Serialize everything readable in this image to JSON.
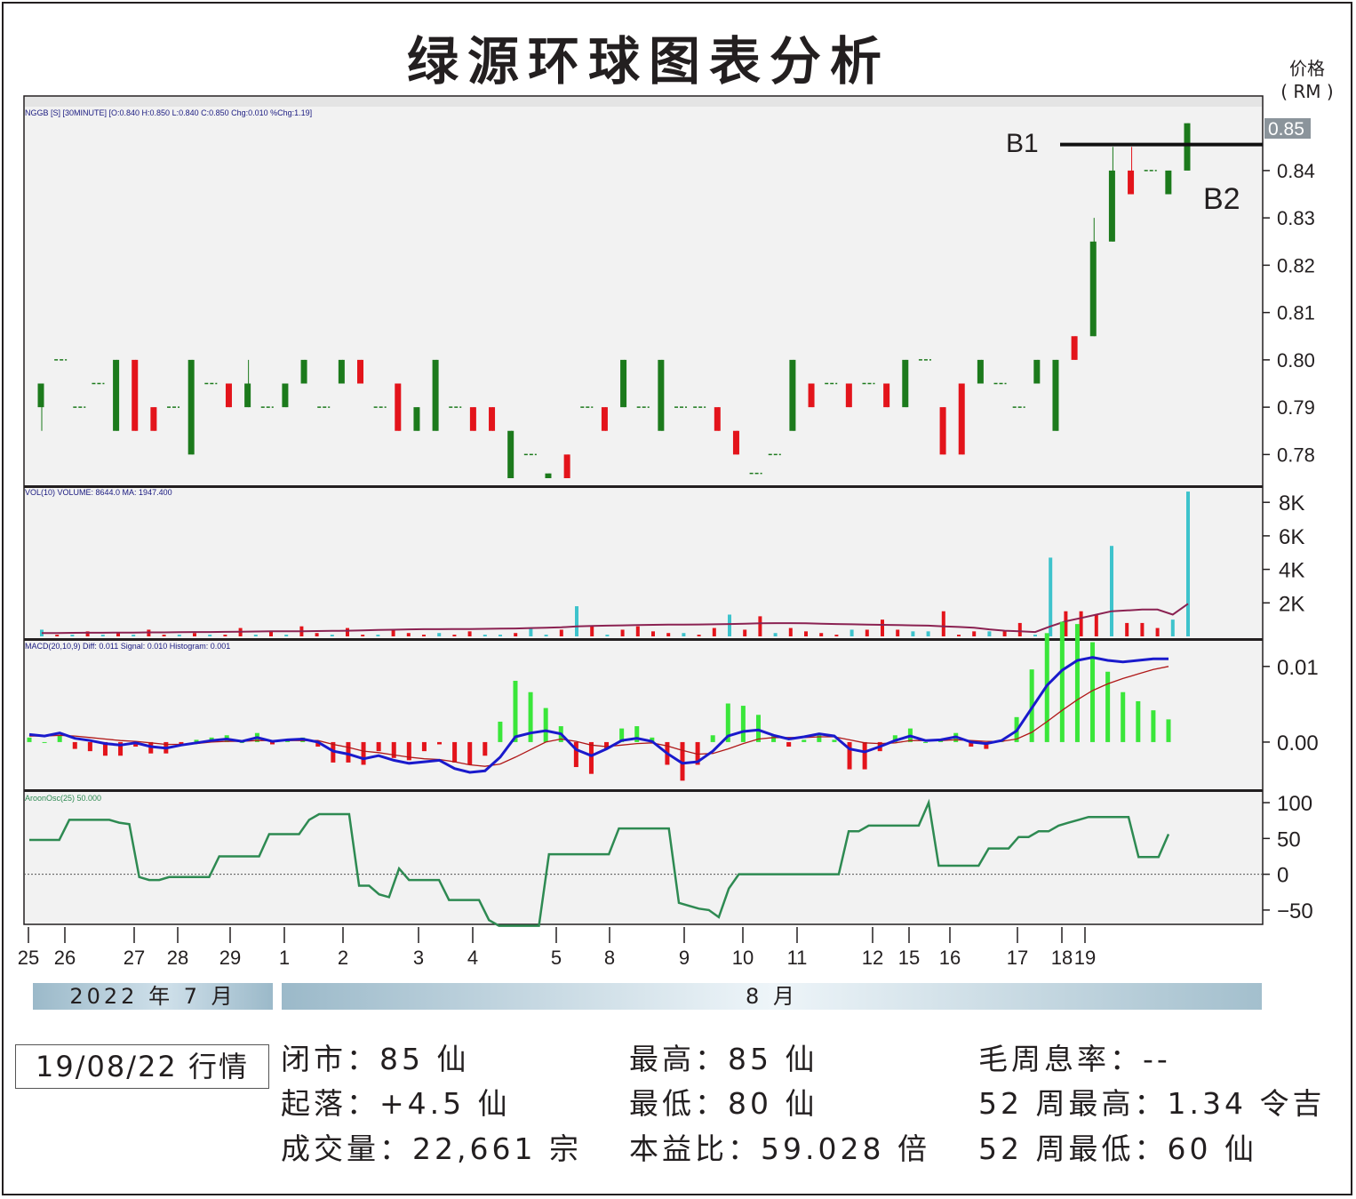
{
  "title": "绿源环球图表分析",
  "price_unit": "价格\n( RM )",
  "annotations": {
    "b1": "B1",
    "b2": "B2",
    "last_price": "0.85"
  },
  "panels": {
    "price_info": "NGGB [S] [30MINUTE] [O:0.840 H:0.850 L:0.840 C:0.850 Chg:0.010 %Chg:1.19]",
    "volume_info": "VOL(10) VOLUME: 8644.0   MA: 1947.400",
    "macd_info": "MACD(20,10,9) Diff: 0.011   Signal: 0.010   Histogram: 0.001",
    "aroon_info": "AroonOsc(25) 50.000"
  },
  "month_labels": {
    "jul": "2022 年 7 月",
    "aug": "8 月"
  },
  "stats": {
    "date": "19/08/22 行情",
    "close": "闭市：85 仙",
    "change": "起落：+4.5 仙",
    "volume": "成交量：22,661 宗",
    "high": "最高：85 仙",
    "low": "最低：80 仙",
    "pe": "本益比：59.028 倍",
    "yield": "毛周息率：--",
    "high52": "52 周最高：1.34 令吉",
    "low52": "52 周最低：60 仙"
  },
  "colors": {
    "up": "#1c7a1c",
    "down": "#e3141b",
    "vol_up": "#3ec3cc",
    "macd": "#1a1acc",
    "signal": "#b01818",
    "hist_up": "#3ae63a",
    "hist_down": "#e3141b",
    "aroon": "#2e8a52",
    "ma": "#8b2252"
  },
  "chart_data": {
    "type": "candlestick",
    "x_tick_labels": [
      "25",
      "26",
      "27",
      "28",
      "29",
      "1",
      "2",
      "3",
      "4",
      "5",
      "8",
      "9",
      "10",
      "11",
      "12",
      "15",
      "16",
      "17",
      "18",
      "19"
    ],
    "x_tick_positions": [
      0,
      2,
      6,
      8,
      10,
      12,
      14,
      16,
      18,
      20,
      22,
      24,
      26,
      28,
      30,
      32,
      34,
      36,
      38,
      39
    ],
    "price_ylim": [
      0.775,
      0.852
    ],
    "price_ticks": [
      "0.78",
      "0.79",
      "0.80",
      "0.81",
      "0.82",
      "0.83",
      "0.84"
    ],
    "resistance_level": 0.8455,
    "candles": [
      [
        0.79,
        0.795,
        0.785,
        0.795
      ],
      [
        0.8,
        0.8,
        0.8,
        0.8
      ],
      [
        0.79,
        0.79,
        0.79,
        0.79
      ],
      [
        0.795,
        0.795,
        0.795,
        0.795
      ],
      [
        0.785,
        0.8,
        0.785,
        0.8
      ],
      [
        0.8,
        0.8,
        0.785,
        0.785
      ],
      [
        0.79,
        0.79,
        0.785,
        0.785
      ],
      [
        0.79,
        0.79,
        0.79,
        0.79
      ],
      [
        0.78,
        0.8,
        0.78,
        0.8
      ],
      [
        0.795,
        0.795,
        0.795,
        0.795
      ],
      [
        0.795,
        0.795,
        0.79,
        0.79
      ],
      [
        0.79,
        0.8,
        0.79,
        0.795
      ],
      [
        0.79,
        0.79,
        0.79,
        0.79
      ],
      [
        0.79,
        0.795,
        0.79,
        0.795
      ],
      [
        0.795,
        0.8,
        0.795,
        0.8
      ],
      [
        0.79,
        0.79,
        0.79,
        0.79
      ],
      [
        0.795,
        0.8,
        0.795,
        0.8
      ],
      [
        0.8,
        0.8,
        0.795,
        0.795
      ],
      [
        0.79,
        0.79,
        0.79,
        0.79
      ],
      [
        0.795,
        0.795,
        0.785,
        0.785
      ],
      [
        0.785,
        0.79,
        0.785,
        0.79
      ],
      [
        0.785,
        0.8,
        0.785,
        0.8
      ],
      [
        0.79,
        0.79,
        0.79,
        0.79
      ],
      [
        0.79,
        0.79,
        0.785,
        0.785
      ],
      [
        0.79,
        0.79,
        0.785,
        0.785
      ],
      [
        0.775,
        0.785,
        0.775,
        0.785
      ],
      [
        0.78,
        0.78,
        0.78,
        0.78
      ],
      [
        0.775,
        0.776,
        0.775,
        0.776
      ],
      [
        0.78,
        0.78,
        0.775,
        0.775
      ],
      [
        0.79,
        0.79,
        0.79,
        0.79
      ],
      [
        0.79,
        0.79,
        0.785,
        0.785
      ],
      [
        0.79,
        0.8,
        0.79,
        0.8
      ],
      [
        0.79,
        0.79,
        0.79,
        0.79
      ],
      [
        0.785,
        0.8,
        0.785,
        0.8
      ],
      [
        0.79,
        0.79,
        0.79,
        0.79
      ],
      [
        0.79,
        0.79,
        0.79,
        0.79
      ],
      [
        0.79,
        0.79,
        0.785,
        0.785
      ],
      [
        0.785,
        0.785,
        0.78,
        0.78
      ],
      [
        0.776,
        0.776,
        0.776,
        0.776
      ],
      [
        0.78,
        0.78,
        0.78,
        0.78
      ],
      [
        0.785,
        0.8,
        0.785,
        0.8
      ],
      [
        0.795,
        0.795,
        0.79,
        0.79
      ],
      [
        0.795,
        0.795,
        0.795,
        0.795
      ],
      [
        0.795,
        0.795,
        0.79,
        0.79
      ],
      [
        0.795,
        0.795,
        0.795,
        0.795
      ],
      [
        0.795,
        0.795,
        0.79,
        0.79
      ],
      [
        0.79,
        0.8,
        0.79,
        0.8
      ],
      [
        0.8,
        0.8,
        0.8,
        0.8
      ],
      [
        0.79,
        0.79,
        0.78,
        0.78
      ],
      [
        0.795,
        0.795,
        0.78,
        0.78
      ],
      [
        0.795,
        0.8,
        0.795,
        0.8
      ],
      [
        0.795,
        0.795,
        0.795,
        0.795
      ],
      [
        0.79,
        0.79,
        0.79,
        0.79
      ],
      [
        0.795,
        0.8,
        0.795,
        0.8
      ],
      [
        0.785,
        0.8,
        0.785,
        0.8
      ],
      [
        0.805,
        0.805,
        0.8,
        0.8
      ],
      [
        0.805,
        0.83,
        0.805,
        0.825
      ],
      [
        0.825,
        0.845,
        0.825,
        0.84
      ],
      [
        0.84,
        0.845,
        0.835,
        0.835
      ],
      [
        0.84,
        0.84,
        0.84,
        0.84
      ],
      [
        0.835,
        0.84,
        0.835,
        0.84
      ],
      [
        0.84,
        0.85,
        0.84,
        0.85
      ]
    ],
    "volume_ylim": [
      0,
      8700
    ],
    "volume_ticks": [
      "8K",
      "6K",
      "4K",
      "2K"
    ],
    "volume": [
      400,
      100,
      100,
      300,
      100,
      200,
      100,
      400,
      100,
      100,
      200,
      100,
      100,
      500,
      100,
      300,
      100,
      600,
      200,
      100,
      500,
      100,
      100,
      400,
      200,
      100,
      200,
      100,
      300,
      100,
      100,
      200,
      500,
      100,
      400,
      1800,
      600,
      100,
      400,
      600,
      300,
      200,
      200,
      100,
      500,
      1300,
      400,
      1200,
      200,
      500,
      300,
      200,
      100,
      400,
      400,
      1000,
      400,
      300,
      300,
      1500,
      100,
      300,
      300,
      300,
      800,
      100,
      4700,
      1500,
      1500,
      1300,
      5400,
      800,
      800,
      500,
      1000,
      8644
    ],
    "volume_up": [
      1,
      0,
      1,
      0,
      1,
      0,
      1,
      0,
      0,
      1,
      0,
      1,
      0,
      0,
      1,
      0,
      1,
      0,
      0,
      1,
      0,
      0,
      1,
      0,
      0,
      0,
      1,
      0,
      0,
      1,
      1,
      0,
      1,
      1,
      0,
      1,
      0,
      1,
      0,
      0,
      0,
      0,
      1,
      0,
      0,
      1,
      0,
      0,
      1,
      0,
      0,
      0,
      0,
      1,
      0,
      0,
      0,
      1,
      1,
      0,
      0,
      0,
      1,
      0,
      0,
      1,
      1,
      0,
      0,
      0,
      1,
      0,
      0,
      0,
      1,
      1
    ],
    "volume_ma": [
      200,
      200,
      210,
      220,
      220,
      230,
      230,
      240,
      240,
      250,
      260,
      260,
      270,
      280,
      290,
      300,
      300,
      310,
      320,
      330,
      340,
      360,
      380,
      400,
      420,
      430,
      430,
      440,
      440,
      450,
      460,
      470,
      500,
      520,
      540,
      600,
      620,
      640,
      660,
      680,
      690,
      700,
      700,
      710,
      720,
      740,
      760,
      780,
      790,
      790,
      780,
      760,
      740,
      720,
      700,
      690,
      680,
      660,
      640,
      600,
      560,
      520,
      420,
      340,
      300,
      260,
      600,
      900,
      1100,
      1300,
      1500,
      1550,
      1600,
      1600,
      1300,
      1947
    ],
    "macd_ylim": [
      -0.006,
      0.0135
    ],
    "macd_ticks": [
      "0.01",
      "0.00"
    ],
    "macd": [
      0.001,
      0.0008,
      0.0012,
      0.0005,
      0.0002,
      -0.0002,
      -0.0004,
      -0.0001,
      -0.0006,
      -0.0008,
      -0.0004,
      -0.0001,
      0.0002,
      0.0004,
      0.0001,
      0.0006,
      0.0001,
      0.0003,
      0.0004,
      0.0,
      -0.0012,
      -0.0016,
      -0.0022,
      -0.0018,
      -0.0024,
      -0.0028,
      -0.0026,
      -0.0024,
      -0.0035,
      -0.004,
      -0.0038,
      -0.002,
      0.0007,
      0.0012,
      0.0015,
      0.0011,
      -0.001,
      -0.0018,
      -0.0009,
      0.0002,
      0.0005,
      0.0001,
      -0.0015,
      -0.0028,
      -0.0026,
      -0.0012,
      0.0008,
      0.0014,
      0.0016,
      0.0009,
      0.0004,
      0.0007,
      0.0011,
      0.0008,
      -0.0009,
      -0.0013,
      -0.0006,
      0.0002,
      0.0008,
      0.0002,
      0.0003,
      0.0007,
      0.0,
      -0.0002,
      0.0002,
      0.0015,
      0.0045,
      0.0075,
      0.0095,
      0.0108,
      0.0112,
      0.0108,
      0.0106,
      0.0108,
      0.011,
      0.011
    ],
    "macd_signal": [
      0.0008,
      0.0008,
      0.0009,
      0.0008,
      0.0006,
      0.0004,
      0.0002,
      0.0001,
      -0.0001,
      -0.0003,
      -0.0003,
      -0.0002,
      0.0,
      0.0001,
      0.0001,
      0.0002,
      0.0002,
      0.0002,
      0.0002,
      0.0002,
      -0.0003,
      -0.0007,
      -0.0012,
      -0.0014,
      -0.0017,
      -0.002,
      -0.0022,
      -0.0023,
      -0.0026,
      -0.003,
      -0.0032,
      -0.0029,
      -0.002,
      -0.001,
      0.0,
      0.0004,
      0.0001,
      -0.0004,
      -0.0006,
      -0.0004,
      -0.0002,
      -0.0001,
      -0.0005,
      -0.0011,
      -0.0016,
      -0.0015,
      -0.0009,
      -0.0002,
      0.0004,
      0.0006,
      0.0006,
      0.0006,
      0.0007,
      0.0007,
      0.0003,
      -0.0001,
      -0.0002,
      -0.0001,
      0.0002,
      0.0002,
      0.0002,
      0.0003,
      0.0002,
      0.0001,
      0.0001,
      0.0004,
      0.0013,
      0.0027,
      0.0042,
      0.0056,
      0.0068,
      0.0077,
      0.0084,
      0.009,
      0.0096,
      0.01
    ],
    "aroon_ylim": [
      -70,
      115
    ],
    "aroon_ticks": [
      "100",
      "50",
      "0",
      "−50"
    ],
    "aroon": [
      48,
      48,
      48,
      48,
      76,
      76,
      76,
      76,
      76,
      72,
      70,
      -4,
      -8,
      -8,
      -4,
      -4,
      -4,
      -4,
      -4,
      25,
      25,
      25,
      25,
      25,
      56,
      56,
      56,
      56,
      76,
      84,
      84,
      84,
      84,
      -16,
      -16,
      -28,
      -32,
      8,
      -8,
      -8,
      -8,
      -8,
      -36,
      -36,
      -36,
      -36,
      -64,
      -72,
      -72,
      -72,
      -72,
      -72,
      28,
      28,
      28,
      28,
      28,
      28,
      28,
      64,
      64,
      64,
      64,
      64,
      64,
      -40,
      -44,
      -48,
      -50,
      -60,
      -20,
      0,
      0,
      0,
      0,
      0,
      0,
      0,
      0,
      0,
      0,
      0,
      60,
      60,
      68,
      68,
      68,
      68,
      68,
      68,
      100,
      12,
      12,
      12,
      12,
      12,
      36,
      36,
      36,
      52,
      52,
      60,
      60,
      68,
      72,
      76,
      80,
      80,
      80,
      80,
      80,
      24,
      24,
      24,
      56
    ]
  }
}
